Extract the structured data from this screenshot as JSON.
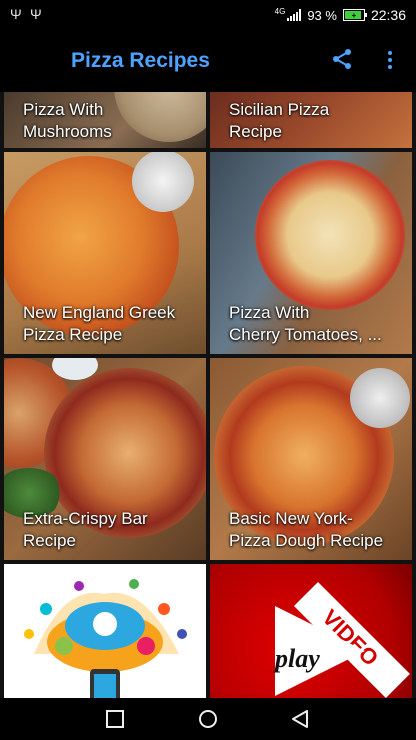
{
  "status": {
    "battery": "93 %",
    "time": "22:36",
    "network": "4G"
  },
  "app": {
    "title": "Pizza Recipes"
  },
  "recipes": [
    {
      "title": "Pizza With Mushrooms",
      "line1": "Pizza With",
      "line2": "Mushrooms"
    },
    {
      "title": "Sicilian Pizza Recipe",
      "line1": "Sicilian Pizza",
      "line2": "Recipe"
    },
    {
      "title": "New England Greek Pizza Recipe",
      "line1": "New England Greek",
      "line2": "Pizza Recipe"
    },
    {
      "title": "Pizza With Cherry Tomatoes, ...",
      "line1": "Pizza With",
      "line2": "Cherry Tomatoes, ..."
    },
    {
      "title": "Extra-Crispy Bar Recipe",
      "line1": "Extra-Crispy Bar",
      "line2": "Recipe"
    },
    {
      "title": "Basic New York-Pizza Dough Recipe",
      "line1": "Basic New York-",
      "line2": "Pizza Dough Recipe"
    }
  ],
  "promos": {
    "video_badge": "VIDEO",
    "play_label": "play"
  },
  "icons": [
    "usb-icon",
    "signal-icon",
    "battery-icon",
    "share-icon",
    "more-vert-icon",
    "recent-apps-icon",
    "home-icon",
    "back-icon"
  ],
  "colors": {
    "title": "#4da3ff",
    "status_bar": "#000000",
    "app_bar": "#000000",
    "battery_fill": "#3bd13b",
    "video_red": "#d40000"
  }
}
